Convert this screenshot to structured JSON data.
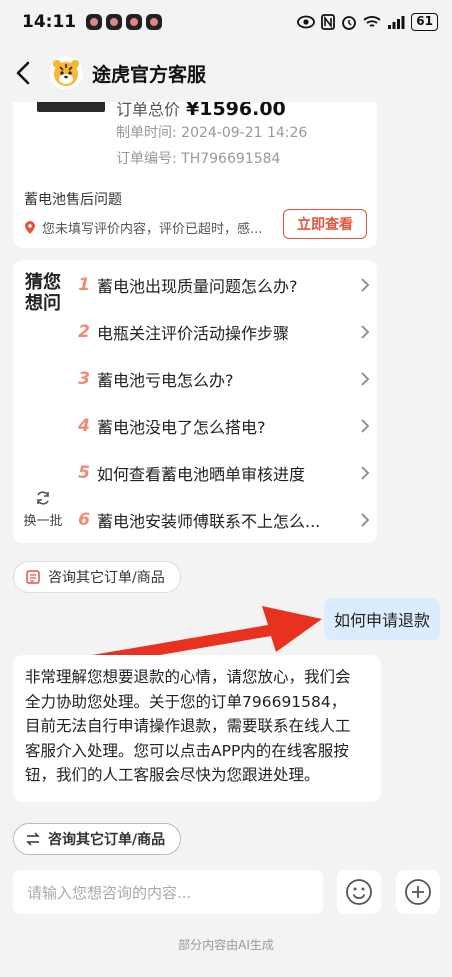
{
  "status_bar": {
    "time": "14:11",
    "battery": "61",
    "icons": [
      "notification-icon",
      "notification-icon",
      "notification-icon",
      "notification-icon",
      "eye-icon",
      "nfc-icon",
      "alarm-icon",
      "wifi-icon",
      "signal-icon"
    ]
  },
  "header": {
    "title": "途虎官方客服"
  },
  "order_card": {
    "total_label": "订单总价",
    "total_value": "¥1596.00",
    "created_time": "制单时间: 2024-09-21 14:26",
    "order_number": "订单编号: TH796691584",
    "issue_title": "蓄电池售后问题",
    "review_note": "您未填写评价内容，评价已超时，感...",
    "view_button": "立即查看"
  },
  "guess": {
    "title_line1": "猜您",
    "title_line2": "想问",
    "refresh_label": "换一批",
    "questions": [
      {
        "num": "1",
        "text": "蓄电池出现质量问题怎么办?"
      },
      {
        "num": "2",
        "text": "电瓶关注评价活动操作步骤"
      },
      {
        "num": "3",
        "text": "蓄电池亏电怎么办?"
      },
      {
        "num": "4",
        "text": "蓄电池没电了怎么搭电?"
      },
      {
        "num": "5",
        "text": "如何查看蓄电池晒单审核进度"
      },
      {
        "num": "6",
        "text": "蓄电池安装师傅联系不上怎么..."
      }
    ]
  },
  "chips": {
    "other_orders_1": "咨询其它订单/商品",
    "other_orders_2": "咨询其它订单/商品"
  },
  "messages": {
    "user": "如何申请退款",
    "bot_lines": [
      "非常理解您想要退款的心情，请您放心，我们会",
      "全力协助您处理。关于您的订单796691584，",
      "目前无法自行申请操作退款，需要联系在线人工",
      "客服介入处理。您可以点击APP内的在线客服按",
      "钮，我们的人工客服会尽快为您跟进处理。"
    ]
  },
  "input": {
    "placeholder": "请输入您想咨询的内容..."
  },
  "footer_note": "部分内容由AI生成",
  "colors": {
    "accent_red": "#e2553e",
    "number_orange": "#f08a72",
    "user_bubble": "#dcecff",
    "background": "#f3f3f3"
  }
}
